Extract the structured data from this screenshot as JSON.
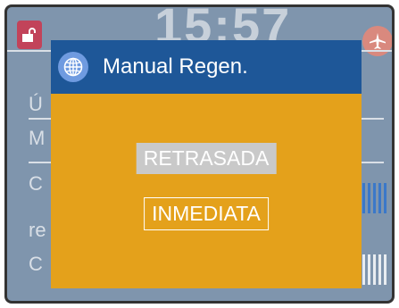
{
  "background_screen": {
    "clock": "15:57",
    "labels": [
      "Ú",
      "M",
      "C",
      "re",
      "C"
    ]
  },
  "dialog": {
    "title": "Manual Regen.",
    "options": [
      {
        "label": "RETRASADA",
        "selected": true
      },
      {
        "label": "INMEDIATA",
        "selected": false
      }
    ]
  },
  "colors": {
    "dialog_header": "#1e5798",
    "dialog_body": "#e4a11b",
    "background": "#7f95ad",
    "selected_option": "#c9c9c9"
  }
}
